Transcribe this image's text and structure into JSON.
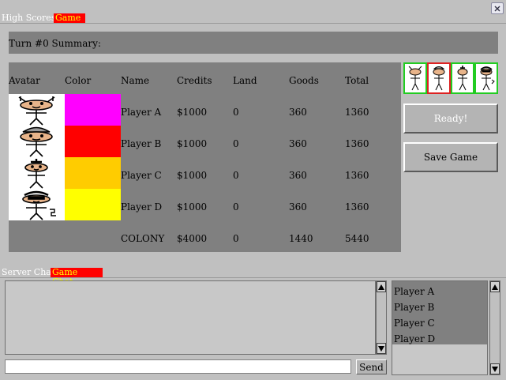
{
  "tabs": {
    "high_scores": "High Scores",
    "game": "Game"
  },
  "summary_title": "Turn #0 Summary:",
  "table": {
    "headers": [
      "Avatar",
      "Color",
      "Name",
      "Credits",
      "Land",
      "Goods",
      "Total"
    ],
    "rows": [
      {
        "color": "#ff00ff",
        "name": "Player A",
        "credits": "$1000",
        "land": "0",
        "goods": "360",
        "total": "1360"
      },
      {
        "color": "#ff0000",
        "name": "Player B",
        "credits": "$1000",
        "land": "0",
        "goods": "360",
        "total": "1360"
      },
      {
        "color": "#ffcc00",
        "name": "Player C",
        "credits": "$1000",
        "land": "0",
        "goods": "360",
        "total": "1360"
      },
      {
        "color": "#ffff00",
        "name": "Player D",
        "credits": "$1000",
        "land": "0",
        "goods": "360",
        "total": "1360"
      }
    ],
    "colony": {
      "name": "COLONY",
      "credits": "$4000",
      "land": "0",
      "goods": "1440",
      "total": "5440"
    }
  },
  "buttons": {
    "ready": "Ready!",
    "save": "Save Game",
    "send": "Send"
  },
  "chat_tabs": {
    "server": "Server Chat",
    "game": "Game Chat"
  },
  "chat_input": {
    "value": "",
    "placeholder": ""
  },
  "player_list": [
    "Player A",
    "Player B",
    "Player C",
    "Player D"
  ],
  "colors": {
    "accent_tab": "#ff0000",
    "panel": "#808080",
    "available_border": "#22cc22",
    "taken_border": "#dd2222"
  }
}
